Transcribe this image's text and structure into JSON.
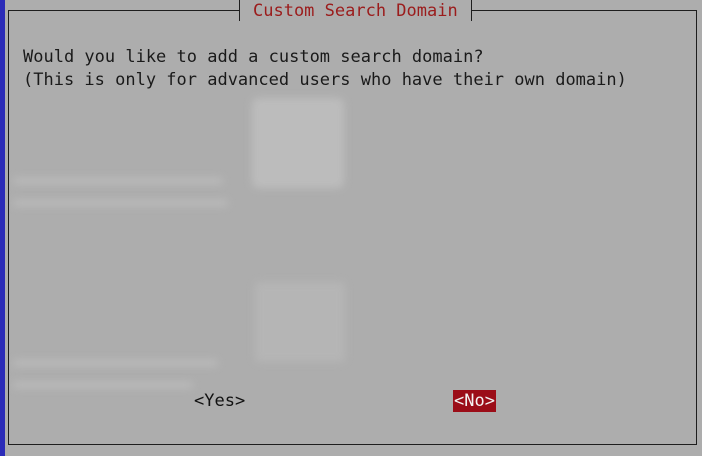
{
  "dialog": {
    "title": "Custom Search Domain",
    "message_line1": "Would you like to add a custom search domain?",
    "message_line2": "(This is only for advanced users who have their own domain)"
  },
  "buttons": {
    "yes_label": "<Yes>",
    "no_label": "<No>",
    "selected": "no"
  },
  "colors": {
    "background": "#adadad",
    "title": "#9b1c1c",
    "selected_button": "#9b0d18",
    "left_edge": "#2b2bb8"
  }
}
